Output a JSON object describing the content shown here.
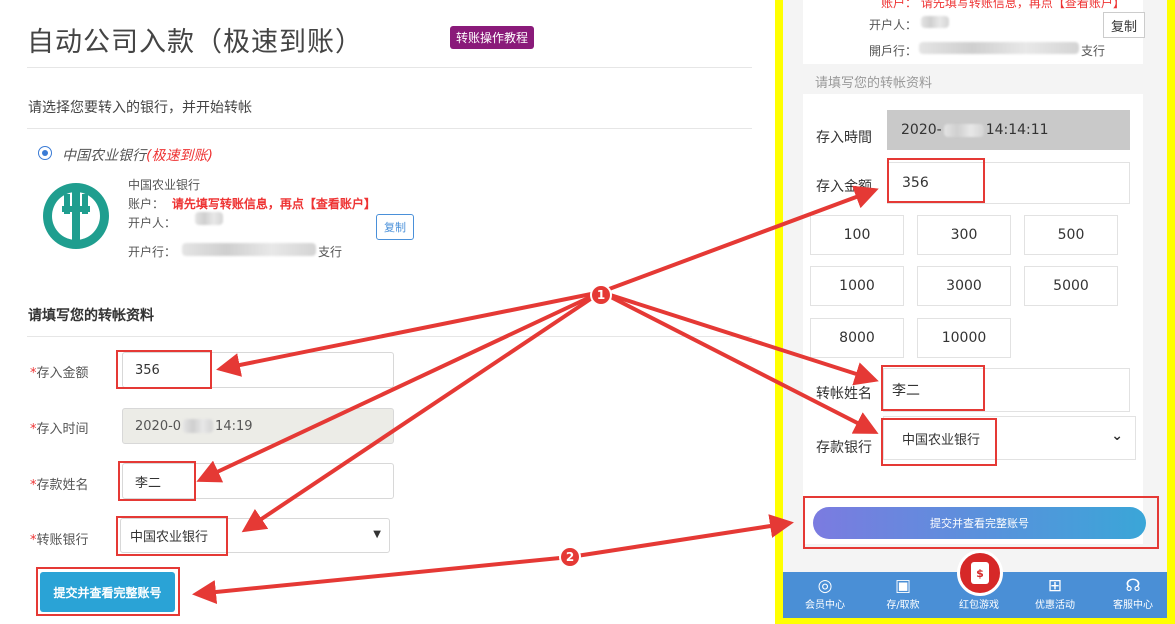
{
  "left": {
    "title": "自动公司入款（极速到账）",
    "tutorial_btn": "转账操作教程",
    "instruction": "请选择您要转入的银行，并开始转帐",
    "bank_option": {
      "name": "中国农业银行",
      "tag": "(极速到账)"
    },
    "bank_info": {
      "name": "中国农业银行",
      "account_label": "账户：",
      "account_hint": "请先填写转账信息，再点【查看账户】",
      "holder_label": "开户人：",
      "branch_label": "开户行：",
      "branch_suffix": "支行",
      "copy_btn": "复制"
    },
    "section_title": "请填写您的转帐资料",
    "form": {
      "amount_label": "存入金额",
      "amount_value": "356",
      "time_label": "存入时间",
      "time_value_a": "2020-0",
      "time_value_b": "14:19",
      "name_label": "存款姓名",
      "name_value": "李二",
      "bank_label": "转账银行",
      "bank_value": "中国农业银行",
      "required_mark": "*"
    },
    "submit": "提交并查看完整账号"
  },
  "right": {
    "top": {
      "account_hint": "账户：  请先填写转账信息，再点【查看账户】",
      "holder_label": "开户人：",
      "copy_btn": "复制",
      "branch_label": "開戶行：",
      "branch_suffix": "支行"
    },
    "section_title": "请填写您的转帐资料",
    "time_label": "存入時間",
    "time_value_a": "2020-",
    "time_value_b": "14:14:11",
    "amount_label": "存入金额",
    "amount_value": "356",
    "amounts": [
      "100",
      "300",
      "500",
      "1000",
      "3000",
      "5000",
      "8000",
      "10000"
    ],
    "name_label": "转帐姓名",
    "name_value": "李二",
    "bank_label": "存款银行",
    "bank_value": "中国农业银行",
    "submit": "提交并查看完整账号",
    "nav": [
      "会员中心",
      "存/取款",
      "红包游戏",
      "优惠活动",
      "客服中心"
    ]
  },
  "annotations": [
    "1",
    "2"
  ],
  "colors": {
    "highlight": "#e53935",
    "divider": "#ffff00",
    "nav": "#4a8fd6",
    "tutorial": "#8a1a7a"
  }
}
